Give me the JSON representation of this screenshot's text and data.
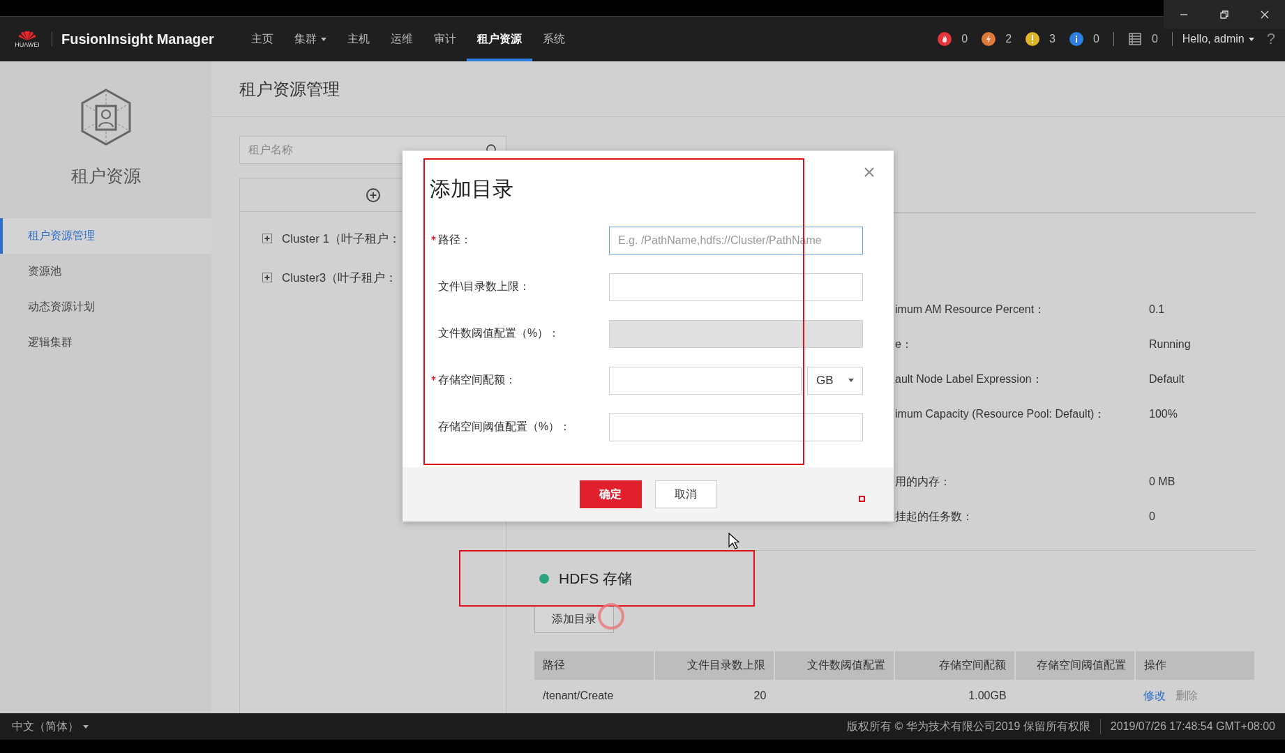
{
  "nav": {
    "logo_text": "HUAWEI",
    "product": "FusionInsight Manager",
    "menu": [
      {
        "label": "主页",
        "selected": false,
        "dropdown": false
      },
      {
        "label": "集群",
        "selected": false,
        "dropdown": true
      },
      {
        "label": "主机",
        "selected": false,
        "dropdown": false
      },
      {
        "label": "运维",
        "selected": false,
        "dropdown": false
      },
      {
        "label": "审计",
        "selected": false,
        "dropdown": false
      },
      {
        "label": "租户资源",
        "selected": true,
        "dropdown": false
      },
      {
        "label": "系统",
        "selected": false,
        "dropdown": false
      }
    ],
    "alarms": [
      {
        "kind": "critical",
        "color": "#e5353a",
        "count": "0"
      },
      {
        "kind": "major",
        "color": "#e07a3a",
        "count": "2"
      },
      {
        "kind": "minor",
        "color": "#e0b52a",
        "count": "3"
      },
      {
        "kind": "info",
        "color": "#2f7fe0",
        "count": "0"
      }
    ],
    "tasks": {
      "count": "0"
    },
    "user": "Hello, admin",
    "help": "?"
  },
  "sidebar": {
    "title": "租户资源",
    "items": [
      {
        "label": "租户资源管理",
        "selected": true
      },
      {
        "label": "资源池",
        "selected": false
      },
      {
        "label": "动态资源计划",
        "selected": false
      },
      {
        "label": "逻辑集群",
        "selected": false
      }
    ]
  },
  "page": {
    "title": "租户资源管理",
    "search": {
      "placeholder": "租户名称"
    },
    "tree": [
      {
        "label": "Cluster 1（叶子租户：",
        "expanded": false
      },
      {
        "label": "Cluster3（叶子租户：",
        "expanded": false
      }
    ],
    "detail_groups": [
      {
        "rows": [
          {
            "label": "imum AM Resource Percent：",
            "value": "0.1"
          },
          {
            "label": "e：",
            "value": "Running"
          },
          {
            "label": "ault Node Label Expression：",
            "value": "Default"
          },
          {
            "label": "imum Capacity (Resource Pool: Default)：",
            "value": "100%"
          }
        ]
      },
      {
        "rows": [
          {
            "label": "用的内存：",
            "value": "0 MB"
          },
          {
            "label": "挂起的任务数：",
            "value": "0"
          }
        ]
      }
    ],
    "hdfs": {
      "title": "HDFS 存储",
      "add_button": "添加目录",
      "columns": [
        "路径",
        "文件目录数上限",
        "文件数阈值配置",
        "存储空间配额",
        "存储空间阈值配置",
        "操作"
      ],
      "rows": [
        {
          "path": "/tenant/Create",
          "file_limit": "20",
          "storage_quota": "1.00GB",
          "actions": [
            {
              "label": "修改",
              "disabled": false
            },
            {
              "label": "删除",
              "disabled": true
            }
          ]
        }
      ]
    }
  },
  "dialog": {
    "title": "添加目录",
    "fields": [
      {
        "label": "路径：",
        "required": true,
        "kind": "text",
        "placeholder": "E.g. /PathName,hdfs://Cluster/PathName",
        "focused": true,
        "disabled": false
      },
      {
        "label": "文件\\目录数上限：",
        "required": false,
        "kind": "text",
        "focused": false,
        "disabled": false
      },
      {
        "label": "文件数阈值配置（%）：",
        "required": false,
        "kind": "text",
        "focused": false,
        "disabled": true
      },
      {
        "label": "存储空间配额：",
        "required": true,
        "kind": "unit",
        "unit": "GB",
        "focused": false,
        "disabled": false
      },
      {
        "label": "存储空间阈值配置（%）：",
        "required": false,
        "kind": "text",
        "focused": false,
        "disabled": false
      }
    ],
    "buttons": [
      {
        "label": "确定",
        "primary": true
      },
      {
        "label": "取消",
        "primary": false
      }
    ]
  },
  "status_bar": {
    "language": "中文（简体）",
    "copyright": "版权所有 © 华为技术有限公司2019 保留所有权限",
    "time": "2019/07/26 17:48:54 GMT+08:00"
  }
}
